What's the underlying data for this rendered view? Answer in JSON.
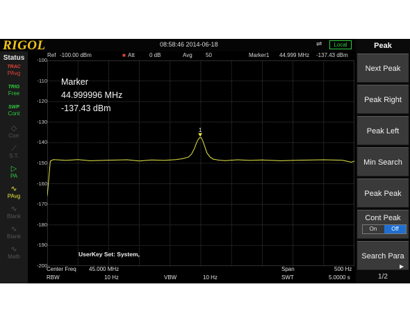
{
  "header": {
    "brand": "RIGOL",
    "datetime": "08:58:46 2014-06-18",
    "remote_status": "Local"
  },
  "status_panel": {
    "title": "Status",
    "items": [
      {
        "icon": "trace-icon",
        "top_text": "TRAC",
        "label": "PAvg",
        "color": "#e0443a"
      },
      {
        "icon": "trig-icon",
        "top_text": "TRIG",
        "label": "Free",
        "color": "#2ecc40"
      },
      {
        "icon": "swp-icon",
        "top_text": "SWP",
        "label": "Cont",
        "color": "#2ecc40"
      },
      {
        "icon": "corr-icon",
        "top_text": "",
        "label": "Corr",
        "color": "#555555"
      },
      {
        "icon": "ext-gain-icon",
        "top_text": "",
        "label": "S.T.",
        "color": "#555555"
      },
      {
        "icon": "pa-icon",
        "top_text": "",
        "label": "PA",
        "color": "#2ecc40"
      },
      {
        "icon": "pavg-icon",
        "top_text": "",
        "label": "PAvg",
        "color": "#e6e63a"
      },
      {
        "icon": "blank-icon",
        "top_text": "",
        "label": "Blank",
        "color": "#555555"
      },
      {
        "icon": "blank-icon",
        "top_text": "",
        "label": "Blank",
        "color": "#555555"
      },
      {
        "icon": "math-icon",
        "top_text": "",
        "label": "Math",
        "color": "#555555"
      }
    ]
  },
  "info_bar": {
    "ref_label": "Ref",
    "ref_value": "-100.00 dBm",
    "att_label": "Att",
    "att_value": "0 dB",
    "avg_label": "Avg",
    "avg_value": "50",
    "marker_label": "Marker1",
    "marker_freq": "44.999 MHz",
    "marker_level": "-137.43 dBm"
  },
  "marker_readout": {
    "title": "Marker",
    "frequency": "44.999996 MHz",
    "level": "-137.43 dBm",
    "marker_number": "1"
  },
  "userkey": "UserKey Set:   System,",
  "bottom_bar": {
    "center_freq_label": "Center Freq",
    "center_freq_value": "45.000 MHz",
    "span_label": "Span",
    "span_value": "500 Hz",
    "rbw_label": "RBW",
    "rbw_value": "10 Hz",
    "vbw_label": "VBW",
    "vbw_value": "10 Hz",
    "swt_label": "SWT",
    "swt_value": "5.0000 s"
  },
  "menu": {
    "title": "Peak",
    "keys": [
      "Next Peak",
      "Peak Right",
      "Peak Left",
      "Min Search",
      "Peak Peak",
      "Cont Peak",
      "Search Para"
    ],
    "cont_peak_on": "On",
    "cont_peak_off": "Off",
    "cont_peak_state": "Off",
    "page": "1/2"
  },
  "colors": {
    "trace": "#e8e84a",
    "grid": "#4a4a4a",
    "accent": "#1f6fd0",
    "logo": "#f2c31a",
    "local": "#2ecc40"
  },
  "chart_data": {
    "type": "line",
    "ylabel": "dBm",
    "ylim": [
      -200,
      -100
    ],
    "yticks": [
      -100,
      -110,
      -120,
      -130,
      -140,
      -150,
      -160,
      -170,
      -180,
      -190,
      -200
    ],
    "x_center_mhz": 45.0,
    "x_span_hz": 500,
    "xlim_hz": [
      -250,
      250
    ],
    "grid": true,
    "series": [
      {
        "x": [
          -250,
          -245,
          -240,
          -230,
          -220,
          -200,
          -180,
          -150,
          -120,
          -100,
          -80,
          -60,
          -40,
          -30,
          -20,
          -15,
          -10,
          -7,
          -4,
          -2,
          -1,
          0,
          1,
          3,
          6,
          10,
          15,
          20,
          30,
          40,
          60,
          80,
          100,
          130,
          160,
          200,
          230,
          245,
          250
        ],
        "values": [
          -166,
          -149,
          -148.2,
          -148.4,
          -148.6,
          -148.2,
          -148.8,
          -148.5,
          -148.3,
          -148.9,
          -148.4,
          -148.6,
          -148.2,
          -147.8,
          -147.0,
          -145.5,
          -142.5,
          -140.0,
          -138.3,
          -137.6,
          -137.43,
          -137.5,
          -137.8,
          -139.0,
          -141.5,
          -145.0,
          -147.0,
          -148.0,
          -148.5,
          -148.7,
          -148.3,
          -148.6,
          -148.4,
          -148.8,
          -148.5,
          -148.3,
          -148.5,
          -149.5,
          -149.0
        ]
      }
    ]
  }
}
